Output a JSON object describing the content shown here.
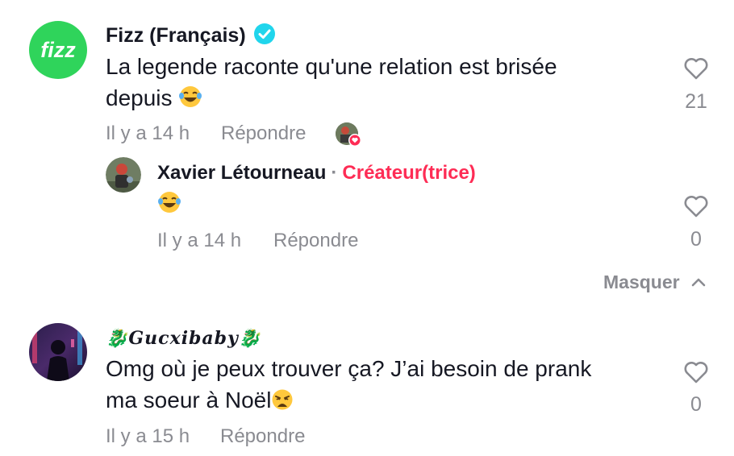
{
  "comments": [
    {
      "author": "Fizz (Français)",
      "verified": true,
      "text_line1": "La legende raconte qu'une relation est brisée",
      "text_line2": "depuis",
      "emoji": "😂",
      "time": "Il y a 14 h",
      "reply_label": "Répondre",
      "likes": "21",
      "brand_color": "#2fd45b",
      "replies": [
        {
          "author": "Xavier Létourneau",
          "separator": "·",
          "badge": "Créateur(trice)",
          "emoji": "😂",
          "time": "Il y a 14 h",
          "reply_label": "Répondre",
          "likes": "0"
        }
      ],
      "collapse_label": "Masquer"
    },
    {
      "author": "🐉𝑮𝒖𝒄𝒙𝒊𝒃𝒂𝒃𝒚🐉",
      "text_line1": "Omg où je peux trouver ça? J’ai besoin de prank",
      "text_line2": "ma soeur à Noël",
      "emoji": "😩",
      "time": "Il y a 15 h",
      "reply_label": "Répondre",
      "likes": "0"
    }
  ],
  "colors": {
    "creator": "#fe2c55",
    "muted": "#8a8b91",
    "verified": "#20d5ec"
  }
}
